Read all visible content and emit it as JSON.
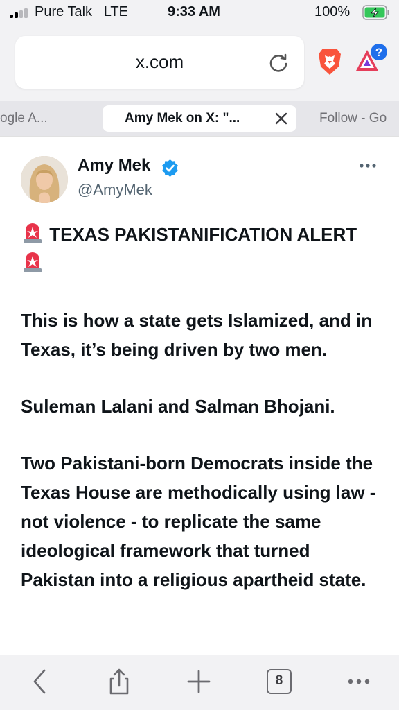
{
  "status": {
    "carrier": "Pure Talk",
    "network": "LTE",
    "time": "9:33 AM",
    "battery": "100%"
  },
  "browser": {
    "url": "x.com",
    "tabs": [
      {
        "label": "ogle A..."
      },
      {
        "label": "Amy Mek on X: \"..."
      },
      {
        "label": "Follow - Go"
      }
    ],
    "open_tab_count": "8",
    "accent_color": "#f9543c"
  },
  "post": {
    "author_name": "Amy Mek",
    "author_handle": "@AmyMek",
    "verified_color": "#1d9bf0",
    "headline_part1": "TEXAS PAKISTANIFICATION ALERT",
    "paragraph1": "This is how a state gets Islamized, and in Texas, it’s being driven by two men.",
    "paragraph2": "Suleman Lalani and Salman Bhojani.",
    "paragraph3": "Two Pakistani-born Democrats inside the Texas House are methodically using law - not violence - to replicate the same ideological framework that turned Pakistan into a religious apartheid state."
  }
}
